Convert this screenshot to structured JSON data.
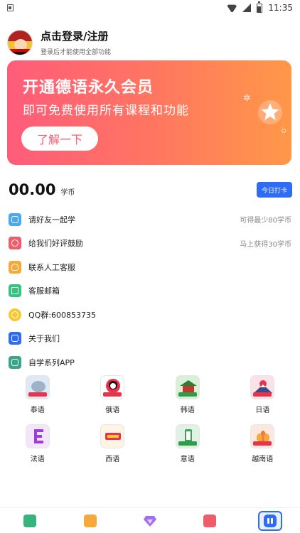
{
  "status_bar": {
    "time": "11:35"
  },
  "profile": {
    "title": "点击登录/注册",
    "subtitle": "登录后才能使用全部功能"
  },
  "banner": {
    "title": "开通德语永久会员",
    "subtitle": "即可免费使用所有课程和功能",
    "button_label": "了解一下",
    "colors": {
      "start": "#ff5c7a",
      "end": "#ff9848"
    }
  },
  "coins": {
    "value": "00.00",
    "unit": "学币",
    "checkin_label": "今日打卡"
  },
  "menu": [
    {
      "label": "请好友一起学",
      "right": "可得最少80学币",
      "icon": "people-icon",
      "color": "#4aa8f0"
    },
    {
      "label": "给我们好评鼓励",
      "right": "马上获得30学币",
      "icon": "smile-icon",
      "color": "#ef5d6b"
    },
    {
      "label": "联系人工客服",
      "right": "",
      "icon": "headset-icon",
      "color": "#f5a93a"
    },
    {
      "label": "客服邮箱",
      "right": "",
      "icon": "mail-icon",
      "color": "#33c47f"
    },
    {
      "label": "QQ群:600853735",
      "right": "",
      "icon": "qq-icon",
      "color": "#f5c930"
    },
    {
      "label": "关于我们",
      "right": "",
      "icon": "info-icon",
      "color": "#2f6cf5"
    },
    {
      "label": "自学系列APP",
      "right": "",
      "icon": "apps-icon",
      "color": "#3aa58a"
    }
  ],
  "apps": [
    {
      "label": "泰语",
      "bg": "#dfe9f5",
      "icon": "elephant-icon"
    },
    {
      "label": "俄语",
      "bg": "#ffffff",
      "icon": "russian-doll-icon"
    },
    {
      "label": "韩语",
      "bg": "#d8f0d6",
      "icon": "korean-palace-icon"
    },
    {
      "label": "日语",
      "bg": "#f9e3e8",
      "icon": "mount-fuji-icon"
    },
    {
      "label": "法语",
      "bg": "#f3e6fb",
      "icon": "letter-e-icon"
    },
    {
      "label": "西语",
      "bg": "#fff4e3",
      "icon": "spanish-icon"
    },
    {
      "label": "意语",
      "bg": "#dff2e4",
      "icon": "italian-icon"
    },
    {
      "label": "越南语",
      "bg": "#fde8e0",
      "icon": "lotus-icon"
    }
  ],
  "bottom_nav": [
    {
      "icon": "book-icon",
      "color": "#36b37e"
    },
    {
      "icon": "cards-icon",
      "color": "#f5a93a"
    },
    {
      "icon": "diamond-icon",
      "color": "#a46ef2"
    },
    {
      "icon": "dictionary-icon",
      "color": "#ef5d6b"
    },
    {
      "icon": "profile-icon",
      "color": "#2f6cf5",
      "active": true
    }
  ]
}
